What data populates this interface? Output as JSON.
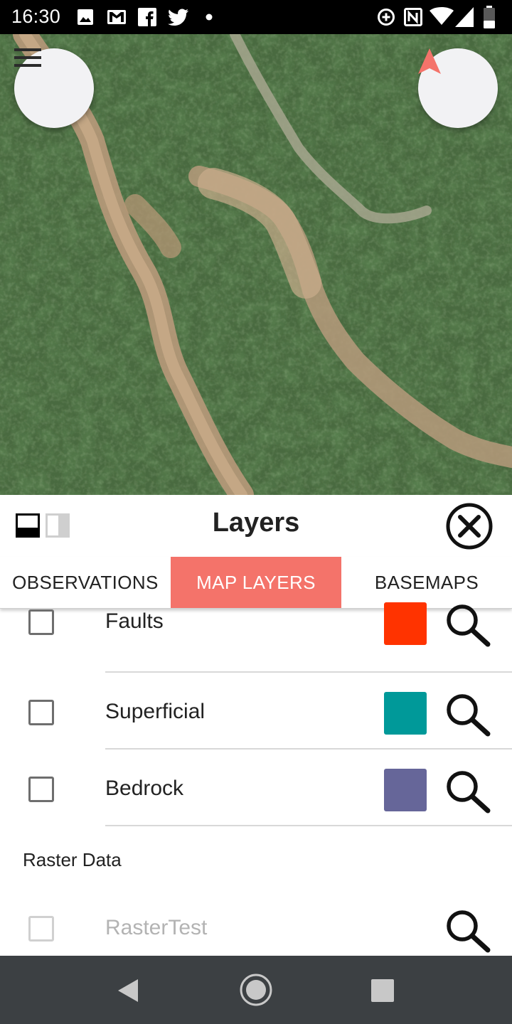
{
  "status_bar": {
    "time": "16:30",
    "icons": [
      "image-icon",
      "gmail-icon",
      "facebook-icon",
      "twitter-icon",
      "dot-icon",
      "data-saver-icon",
      "nfc-icon",
      "wifi-icon",
      "signal-icon",
      "battery-icon"
    ]
  },
  "map": {
    "menu_icon": "hamburger-menu-icon",
    "nav_icon": "navigation-arrow-icon",
    "accent": "#f4736a"
  },
  "panel": {
    "title": "Layers",
    "tabs": [
      {
        "label": "OBSERVATIONS",
        "active": false
      },
      {
        "label": "MAP LAYERS",
        "active": true
      },
      {
        "label": "BASEMAPS",
        "active": false
      }
    ],
    "layers": [
      {
        "label": "Faults",
        "color": "#ff3300",
        "checked": false
      },
      {
        "label": "Superficial",
        "color": "#009999",
        "checked": false
      },
      {
        "label": "Bedrock",
        "color": "#666699",
        "checked": false
      }
    ],
    "raster_section": "Raster Data",
    "raster_layers": [
      {
        "label": "RasterTest",
        "enabled": false,
        "checked": false
      }
    ]
  },
  "nav_bar": {
    "icons": [
      "back-icon",
      "home-icon",
      "recents-icon"
    ]
  }
}
